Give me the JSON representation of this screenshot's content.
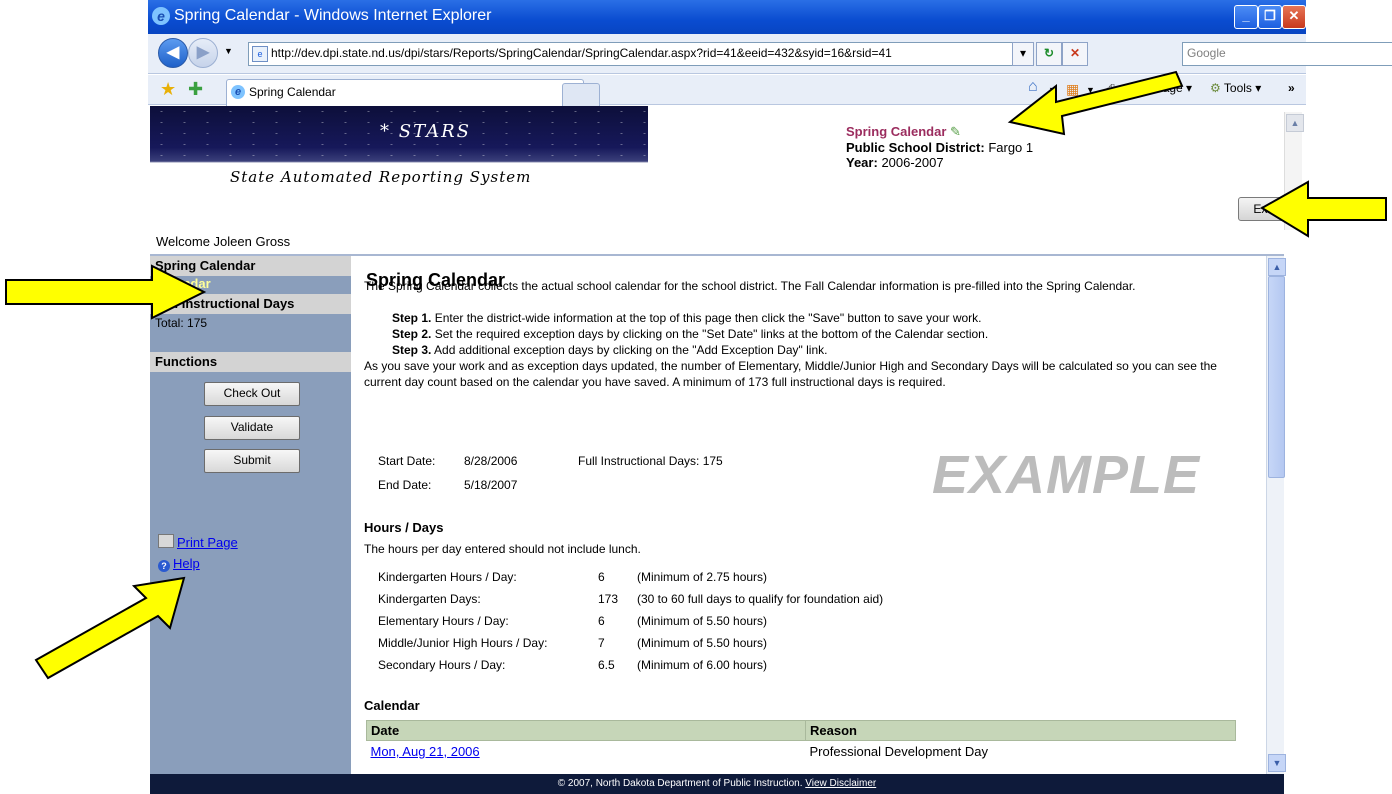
{
  "window": {
    "title": "Spring Calendar - Windows Internet Explorer"
  },
  "browser": {
    "url": "http://dev.dpi.state.nd.us/dpi/stars/Reports/SpringCalendar/SpringCalendar.aspx?rid=41&eeid=432&syid=16&rsid=41",
    "search_placeholder": "Google",
    "tab_label": "Spring Calendar",
    "page_menu": "Page",
    "tools_menu": "Tools"
  },
  "banner": {
    "title": "STARS",
    "subtitle": "State Automated Reporting System"
  },
  "report": {
    "title": "Spring Calendar",
    "district_label": "Public School District:",
    "district_value": "Fargo 1",
    "year_label": "Year:",
    "year_value": "2006-2007"
  },
  "welcome": "Welcome Joleen Gross",
  "exit_button": "Exit Report",
  "sidebar": {
    "section1_title": "Spring Calendar",
    "section1_item": "Calendar",
    "section2_title": "Full Instructional Days",
    "total": "Total:  175",
    "section3_title": "Functions",
    "buttons": [
      "Check Out",
      "Validate",
      "Submit"
    ],
    "print_page": "Print Page",
    "help": "Help"
  },
  "main": {
    "heading": "Spring Calendar",
    "intro": "The Spring Calendar collects the actual school calendar for the school district. The Fall Calendar information is pre-filled into the Spring Calendar.",
    "steps": [
      {
        "label": "Step 1.",
        "text": " Enter the district-wide information at the top of this page then click the \"Save\" button to save your work."
      },
      {
        "label": "Step 2.",
        "text": " Set the required exception days by clicking on the \"Set Date\" links at the bottom of the Calendar section."
      },
      {
        "label": "Step 3.",
        "text": " Add additional exception days by clicking on the \"Add Exception Day\" link."
      }
    ],
    "note": "As you save your work and as exception days updated, the number of Elementary, Middle/Junior High and Secondary Days will be calculated so you can see the current day count based on the calendar you have saved. A minimum of 173 full instructional days is required.",
    "start_date_label": "Start Date:",
    "start_date": "8/28/2006",
    "end_date_label": "End Date:",
    "end_date": "5/18/2007",
    "full_days": "Full Instructional Days: 175",
    "watermark": "EXAMPLE",
    "hours_heading": "Hours / Days",
    "hours_note": "The hours per day entered should not include lunch.",
    "hours_rows": [
      {
        "label": "Kindergarten Hours / Day:",
        "value": "6",
        "note": "(Minimum of 2.75 hours)"
      },
      {
        "label": "Kindergarten Days:",
        "value": "173",
        "note": "(30 to 60 full days to qualify for foundation aid)"
      },
      {
        "label": "Elementary Hours / Day:",
        "value": "6",
        "note": "(Minimum of 5.50 hours)"
      },
      {
        "label": "Middle/Junior High Hours / Day:",
        "value": "7",
        "note": "(Minimum of 5.50 hours)"
      },
      {
        "label": "Secondary Hours / Day:",
        "value": "6.5",
        "note": "(Minimum of 6.00 hours)"
      }
    ],
    "calendar_heading": "Calendar",
    "calendar_columns": [
      "Date",
      "Reason"
    ],
    "calendar_rows": [
      {
        "date": "Mon, Aug 21, 2006",
        "reason": "Professional Development Day"
      }
    ]
  },
  "footer": {
    "text": "© 2007, North Dakota Department of Public Instruction. ",
    "link": "View Disclaimer"
  },
  "colors": {
    "sidebar_bg": "#8a9ebb",
    "report_title": "#9b2c5e",
    "arrow_fill": "#ffff00",
    "footer_bg": "#0e1a3a"
  }
}
